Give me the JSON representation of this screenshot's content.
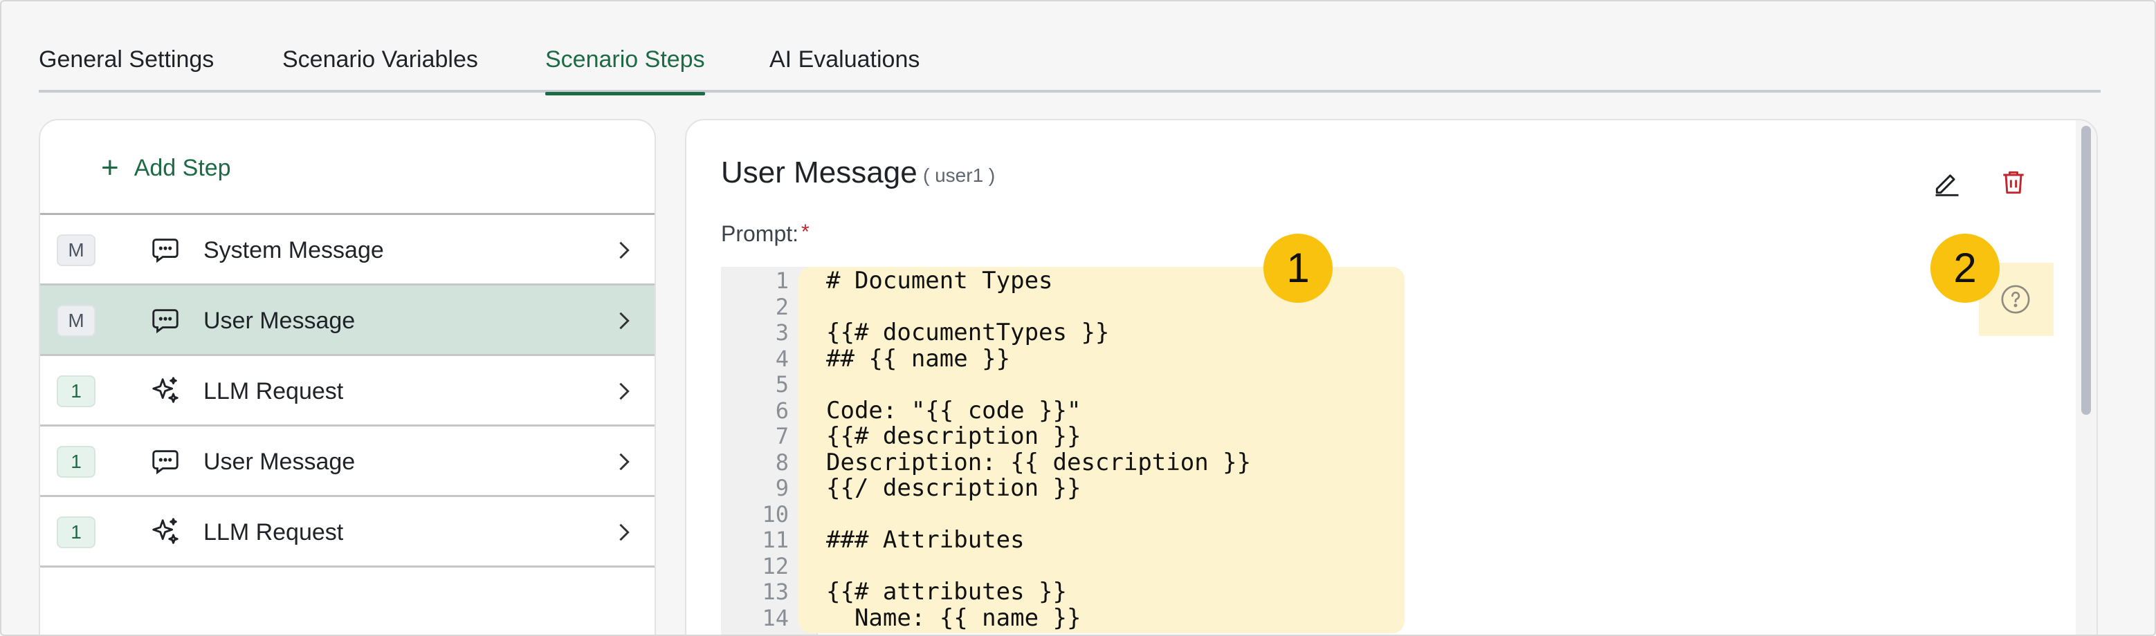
{
  "tabs": [
    {
      "label": "General Settings"
    },
    {
      "label": "Scenario Variables"
    },
    {
      "label": "Scenario Steps"
    },
    {
      "label": "AI Evaluations"
    }
  ],
  "active_tab": "Scenario Steps",
  "steps_panel": {
    "add_step_label": "Add Step",
    "items": [
      {
        "badge": "M",
        "icon": "chat-bubble-icon",
        "label": "System Message"
      },
      {
        "badge": "M",
        "icon": "chat-bubble-icon",
        "label": "User Message",
        "selected": true
      },
      {
        "badge": "1",
        "icon": "sparkle-icon",
        "label": "LLM Request"
      },
      {
        "badge": "1",
        "icon": "chat-bubble-icon",
        "label": "User Message"
      },
      {
        "badge": "1",
        "icon": "sparkle-icon",
        "label": "LLM Request"
      }
    ]
  },
  "detail": {
    "title": "User Message",
    "subtitle": "( user1 )",
    "prompt_label": "Prompt:",
    "required_mark": "*",
    "editor": {
      "line_numbers": [
        "1",
        "2",
        "3",
        "4",
        "5",
        "6",
        "7",
        "8",
        "9",
        "10",
        "11",
        "12",
        "13",
        "14"
      ],
      "lines": [
        "# Document Types",
        "",
        "{{# documentTypes }}",
        "## {{ name }}",
        "",
        "Code: \"{{ code }}\"",
        "{{# description }}",
        "Description: {{ description }}",
        "{{/ description }}",
        "",
        "### Attributes",
        "",
        "{{# attributes }}",
        "  Name: {{ name }}"
      ]
    }
  },
  "markers": [
    "1",
    "2"
  ],
  "colors": {
    "accent": "#1d6b45",
    "selected_row": "#d2e3dc",
    "highlight": "#fdf3cf",
    "marker": "#f8c20e",
    "danger": "#c0262d"
  }
}
